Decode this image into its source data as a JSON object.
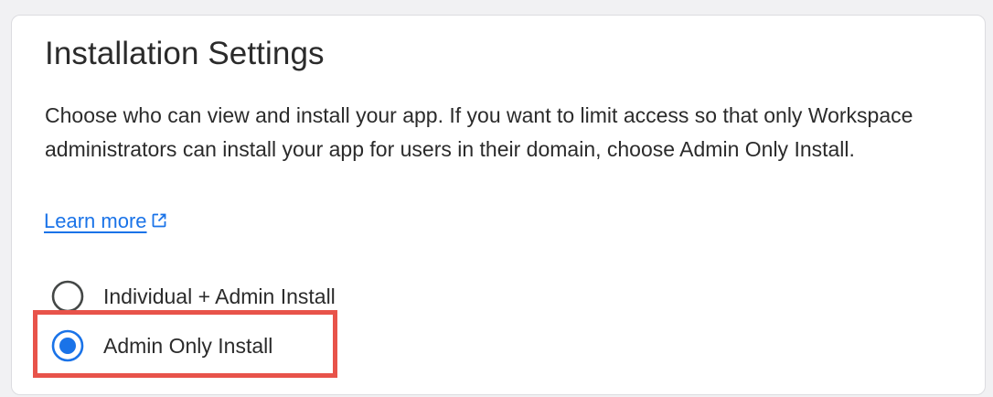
{
  "settings": {
    "title": "Installation Settings",
    "description": "Choose who can view and install your app. If you want to limit access so that only Workspace administrators can install your app for users in their domain, choose Admin Only Install.",
    "learn_more": "Learn more",
    "options": [
      {
        "label": "Individual + Admin Install",
        "selected": false
      },
      {
        "label": "Admin Only Install",
        "selected": true
      }
    ]
  },
  "colors": {
    "accent": "#1a73e8",
    "highlight": "#e8534a",
    "radio_unselected": "#444746"
  },
  "icons": {
    "learn_more": "open-in-new-icon"
  }
}
